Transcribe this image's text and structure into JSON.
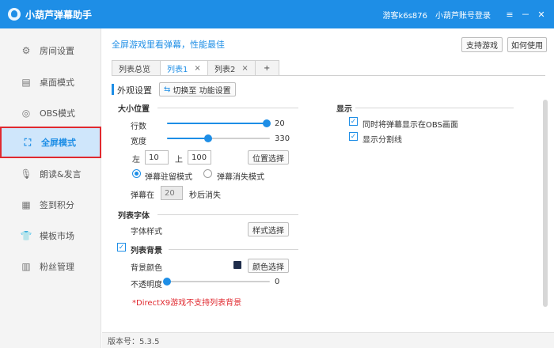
{
  "app": {
    "title": "小葫芦弹幕助手",
    "guest": "游客k6s876",
    "login": "小葫芦账号登录",
    "menu_icon": "≡",
    "minimize_icon": "－",
    "close_icon": "✕"
  },
  "sidebar": {
    "items": [
      {
        "label": "房间设置",
        "icon": "gear-icon",
        "glyph": "⚙"
      },
      {
        "label": "桌面模式",
        "icon": "monitor-icon",
        "glyph": "▤"
      },
      {
        "label": "OBS模式",
        "icon": "obs-icon",
        "glyph": "◎"
      },
      {
        "label": "全屏模式",
        "icon": "fullscreen-icon",
        "glyph": "⛶"
      },
      {
        "label": "朗读&发言",
        "icon": "microphone-icon",
        "glyph": "🎙"
      },
      {
        "label": "签到积分",
        "icon": "calendar-icon",
        "glyph": "▦"
      },
      {
        "label": "模板市场",
        "icon": "shirt-icon",
        "glyph": "👕"
      },
      {
        "label": "粉丝管理",
        "icon": "book-icon",
        "glyph": "▥"
      }
    ]
  },
  "main": {
    "banner": "全屏游戏里看弹幕，性能最佳",
    "support_games": "支持游戏",
    "how_to_use": "如何使用",
    "tabs": [
      {
        "label": "列表总览"
      },
      {
        "label": "列表1",
        "close": "×"
      },
      {
        "label": "列表2",
        "close": "×"
      },
      {
        "label": "+"
      }
    ],
    "appearance_title": "外观设置",
    "switch_button": "切换至 功能设置",
    "size_position": {
      "title": "大小位置",
      "rows_label": "行数",
      "rows_value": "20",
      "rows_fraction": 0.97,
      "width_label": "宽度",
      "width_value": "330",
      "width_fraction": 0.4,
      "left_label": "左",
      "left_value": "10",
      "top_label": "上",
      "top_value": "100",
      "position_button": "位置选择",
      "mode_stay": "弹幕驻留模式",
      "mode_vanish": "弹幕消失模式",
      "vanish_prefix": "弹幕在",
      "vanish_value": "20",
      "vanish_suffix": "秒后消失"
    },
    "font": {
      "title": "列表字体",
      "style_label": "字体样式",
      "style_button": "样式选择"
    },
    "background": {
      "title": "列表背景",
      "checked": true,
      "color_label": "背景颜色",
      "color": "#1f2d4b",
      "color_button": "颜色选择",
      "opacity_label": "不透明度",
      "opacity_value": "0",
      "opacity_fraction": 0.0,
      "warning": "*DirectX9游戏不支持列表背景"
    },
    "display": {
      "title": "显示",
      "show_obs": "同时将弹幕显示在OBS画面",
      "show_divider": "显示分割线"
    },
    "footer": "版本号：5.3.5"
  },
  "colors": {
    "accent": "#1e8ee6",
    "highlight_border": "#e0292f",
    "warning": "#e0292f"
  }
}
